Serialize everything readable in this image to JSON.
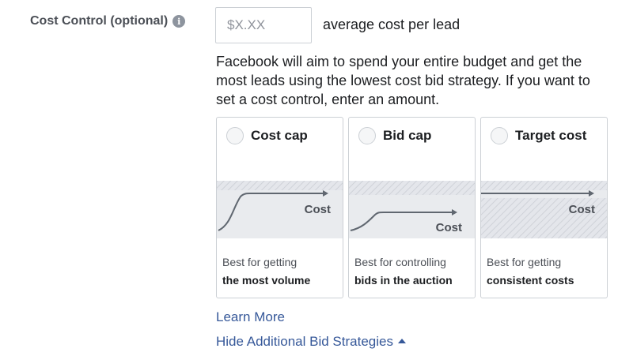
{
  "field": {
    "label": "Cost Control (optional)",
    "info_icon": "info-icon",
    "input_placeholder": "$X.XX",
    "input_value": "",
    "input_suffix": "average cost per lead"
  },
  "description": "Facebook will aim to spend your entire budget and get the most leads using the lowest cost bid strategy. If you want to set a cost control, enter an amount.",
  "strategies": [
    {
      "title": "Cost cap",
      "graph_label": "Cost",
      "desc_line1": "Best for getting",
      "desc_line2": "the most volume",
      "selected": false
    },
    {
      "title": "Bid cap",
      "graph_label": "Cost",
      "desc_line1": "Best for controlling",
      "desc_line2": "bids in the auction",
      "selected": false
    },
    {
      "title": "Target cost",
      "graph_label": "Cost",
      "desc_line1": "Best for getting",
      "desc_line2": "consistent costs",
      "selected": false
    }
  ],
  "links": {
    "learn_more": "Learn More",
    "hide_strategies": "Hide Additional Bid Strategies"
  },
  "colors": {
    "link": "#365899",
    "graph_fill": "#e9ebee",
    "graph_line": "#606770"
  }
}
